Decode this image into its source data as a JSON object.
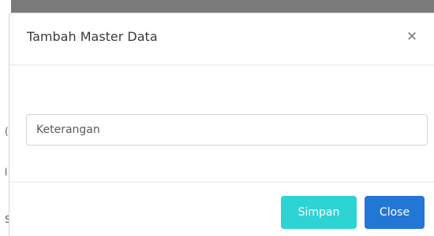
{
  "background": {
    "fragments": [
      "(",
      "l",
      "S"
    ]
  },
  "modal": {
    "title": "Tambah Master Data",
    "close_glyph": "×",
    "input": {
      "placeholder": "Keterangan",
      "value": ""
    },
    "footer": {
      "save_label": "Simpan",
      "close_label": "Close"
    }
  },
  "colors": {
    "save_button": "#2ed3d3",
    "close_button": "#2277d6",
    "backdrop": "#7a7a7a"
  }
}
